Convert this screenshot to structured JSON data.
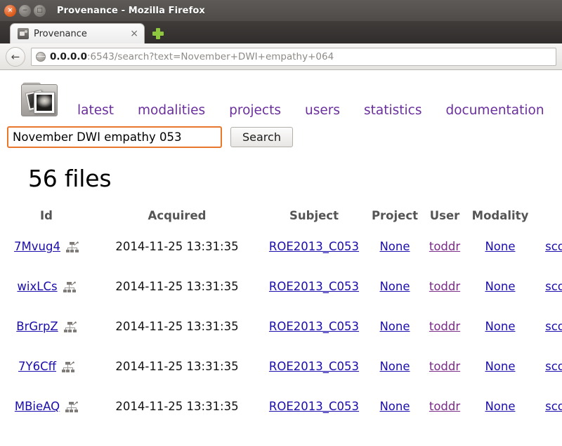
{
  "window": {
    "title": "Provenance - Mozilla Firefox",
    "close_glyph": "×",
    "minimize_glyph": "−",
    "maximize_glyph": "□"
  },
  "tab": {
    "title": "Provenance",
    "close_glyph": "×",
    "favicon_name": "page-favicon",
    "newtab_label": "+"
  },
  "navbar": {
    "back_glyph": "←",
    "url_host": "0.0.0.0",
    "url_rest": ":6543/search?text=November+DWI+empathy+064"
  },
  "site": {
    "logo_name": "provenance-folder-logo",
    "nav": [
      {
        "label": "latest"
      },
      {
        "label": "modalities"
      },
      {
        "label": "projects"
      },
      {
        "label": "users"
      },
      {
        "label": "statistics"
      },
      {
        "label": "documentation"
      }
    ]
  },
  "search": {
    "value": "November DWI empathy 053",
    "placeholder": "",
    "button_label": "Search"
  },
  "results": {
    "heading": "56 files",
    "columns": [
      "Id",
      "Acquired",
      "Subject",
      "Project",
      "User",
      "Modality",
      ""
    ],
    "rows": [
      {
        "id": "7Mvug4",
        "acquired": "2014-11-25 13:31:35",
        "subject": "ROE2013_C053",
        "project": "None",
        "user": "toddr",
        "modality": "None",
        "extra": "sco"
      },
      {
        "id": "wixLCs",
        "acquired": "2014-11-25 13:31:35",
        "subject": "ROE2013_C053",
        "project": "None",
        "user": "toddr",
        "modality": "None",
        "extra": "sco"
      },
      {
        "id": "BrGrpZ",
        "acquired": "2014-11-25 13:31:35",
        "subject": "ROE2013_C053",
        "project": "None",
        "user": "toddr",
        "modality": "None",
        "extra": "sco"
      },
      {
        "id": "7Y6Cff",
        "acquired": "2014-11-25 13:31:35",
        "subject": "ROE2013_C053",
        "project": "None",
        "user": "toddr",
        "modality": "None",
        "extra": "sco"
      },
      {
        "id": "MBieAQ",
        "acquired": "2014-11-25 13:31:35",
        "subject": "ROE2013_C053",
        "project": "None",
        "user": "toddr",
        "modality": "None",
        "extra": "sco"
      }
    ]
  },
  "colors": {
    "link": "#1a0dab",
    "visited_link": "#7a2a87",
    "nav_link": "#6a2f9c",
    "focus_border": "#e8762c",
    "titlebar": "#4e4b49"
  }
}
